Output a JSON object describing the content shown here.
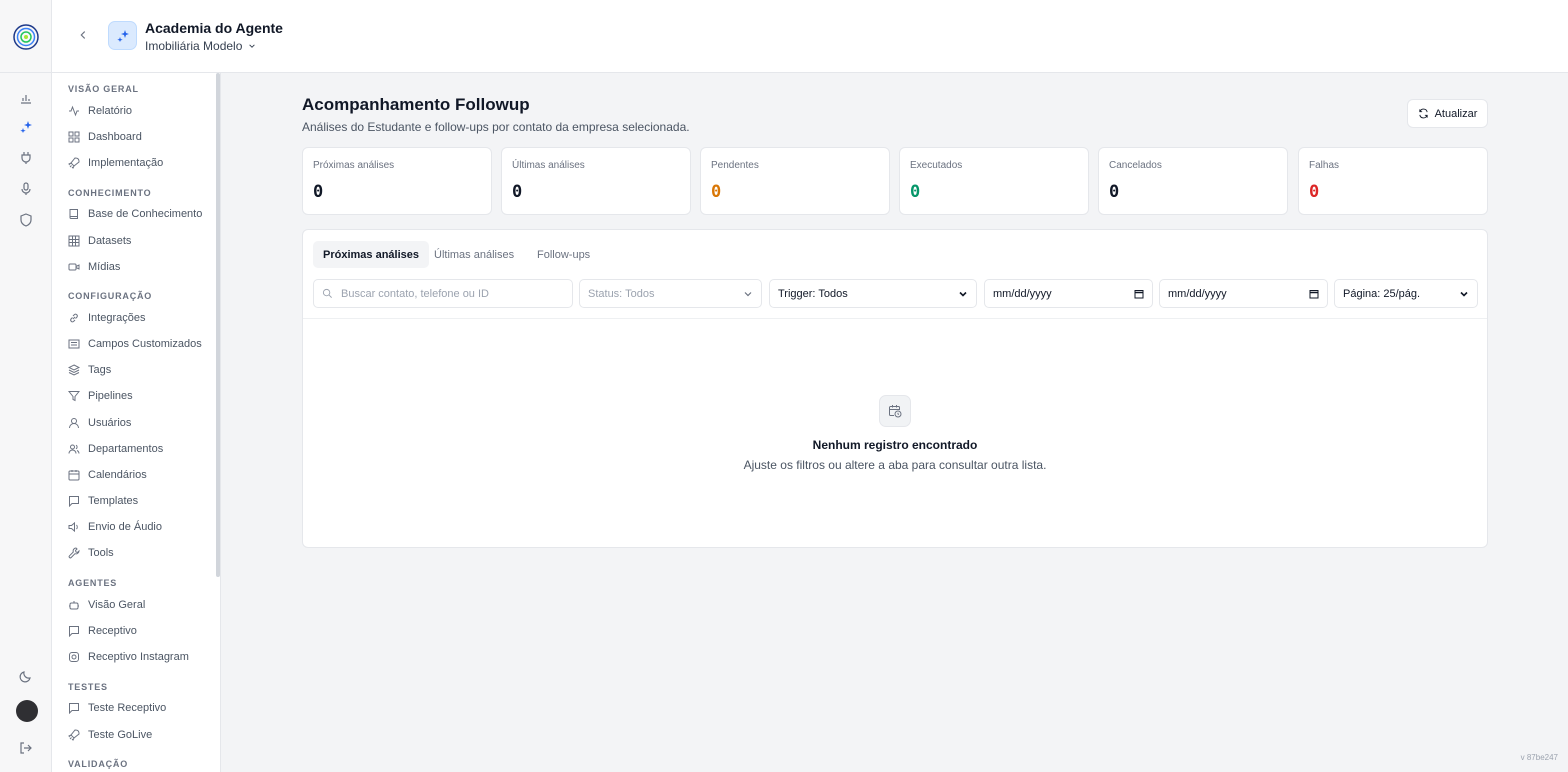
{
  "header": {
    "app_title": "Academia do Agente",
    "company": "Imobiliária Modelo"
  },
  "sidebar": {
    "sections": [
      {
        "label": "VISÃO GERAL",
        "items": [
          "Relatório",
          "Dashboard",
          "Implementação"
        ]
      },
      {
        "label": "CONHECIMENTO",
        "items": [
          "Base de Conhecimento",
          "Datasets",
          "Mídias"
        ]
      },
      {
        "label": "CONFIGURAÇÃO",
        "items": [
          "Integrações",
          "Campos Customizados",
          "Tags",
          "Pipelines",
          "Usuários",
          "Departamentos",
          "Calendários",
          "Templates",
          "Envio de Áudio",
          "Tools"
        ]
      },
      {
        "label": "AGENTES",
        "items": [
          "Visão Geral",
          "Receptivo",
          "Receptivo Instagram"
        ]
      },
      {
        "label": "TESTES",
        "items": [
          "Teste Receptivo",
          "Teste GoLive"
        ]
      },
      {
        "label": "VALIDAÇÃO",
        "items": []
      }
    ]
  },
  "main": {
    "title": "Acompanhamento Followup",
    "subtitle": "Análises do Estudante e follow-ups por contato da empresa selecionada.",
    "refresh_label": "Atualizar",
    "stats": [
      {
        "label": "Próximas análises",
        "value": "0",
        "color": "#111827"
      },
      {
        "label": "Últimas análises",
        "value": "0",
        "color": "#111827"
      },
      {
        "label": "Pendentes",
        "value": "0",
        "color": "#d97706"
      },
      {
        "label": "Executados",
        "value": "0",
        "color": "#059669"
      },
      {
        "label": "Cancelados",
        "value": "0",
        "color": "#111827"
      },
      {
        "label": "Falhas",
        "value": "0",
        "color": "#dc2626"
      }
    ],
    "tabs": [
      "Próximas análises",
      "Últimas análises",
      "Follow-ups"
    ],
    "active_tab": 0,
    "filters": {
      "search_placeholder": "Buscar contato, telefone ou ID",
      "status": "Status: Todos",
      "trigger": "Trigger: Todos",
      "date_from": "mm/dd/yyyy",
      "date_to": "mm/dd/yyyy",
      "page_size": "Página: 25/pág."
    },
    "empty": {
      "title": "Nenhum registro encontrado",
      "description": "Ajuste os filtros ou altere a aba para consultar outra lista."
    }
  },
  "version": "v 87be247",
  "colors": {
    "accent": "#2563eb",
    "badge_bg": "#dbeafe"
  }
}
